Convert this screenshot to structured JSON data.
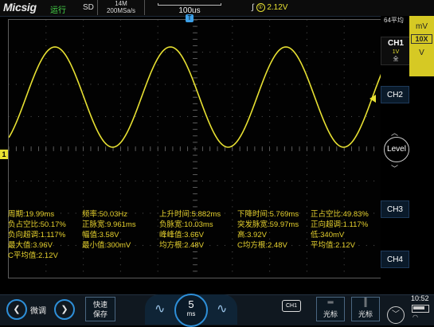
{
  "topbar": {
    "logo": "Micsig",
    "run_state": "运行",
    "storage": "SD",
    "memory_depth": "14M",
    "sample_rate": "200MSa/s",
    "timebase": "100us",
    "trigger_edge_symbol": "∫",
    "trigger_source": "①",
    "trigger_level": "2.12V"
  },
  "markers": {
    "ch1": "1",
    "trigger_time": "T"
  },
  "waveform": {
    "color": "#e7e032",
    "channel": "CH1"
  },
  "measurements": [
    [
      "周期:19.99ms",
      "频率:50.03Hz",
      "上升时间:5.882ms",
      "下降时间:5.769ms",
      "正占空比:49.83%"
    ],
    [
      "负占空比:50.17%",
      "正脉宽:9.961ms",
      "负脉宽:10.03ms",
      "突发脉宽:59.97ms",
      "正向超调:1.117%"
    ],
    [
      "负向超调:1.117%",
      "幅值:3.58V",
      "峰峰值:3.66V",
      "高:3.92V",
      "低:340mV"
    ],
    [
      "最大值:3.96V",
      "最小值:300mV",
      "均方根:2.48V",
      "C均方根:2.48V",
      "平均值:2.12V"
    ],
    [
      "C平均值:2.12V"
    ]
  ],
  "right_panel": {
    "acq_mode": "64平均",
    "ch1_title": "CH1",
    "ch1_scale": "1V",
    "ch1_coupling": "全",
    "unit_mv": "mV",
    "probe": "10X",
    "unit_v": "V",
    "ch2": "CH2",
    "ch3": "CH3",
    "ch4": "CH4",
    "level": "Level",
    "up_arrow": "︿",
    "down_arrow": "﹀"
  },
  "bottombar": {
    "prev": "❮",
    "next": "❯",
    "fine_adjust": "微调",
    "quick_save_line1": "快速",
    "quick_save_line2": "保存",
    "timebase_value": "5",
    "timebase_unit": "ms",
    "tilde": "∿",
    "ch1_chip": "CH1",
    "cursor_h": "光标",
    "cursor_v": "光标",
    "down_circle": "﹀",
    "clock": "10:52",
    "wifi": "◠"
  }
}
